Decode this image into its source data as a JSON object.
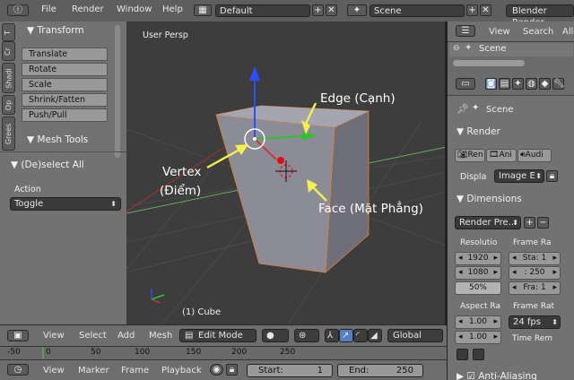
{
  "top_menu": {
    "file": "File",
    "render": "Render",
    "window": "Window",
    "help": "Help",
    "screen_layout": "Default",
    "scene": "Scene",
    "engine": "Blender Render"
  },
  "toolshelf": {
    "tabs": [
      "T",
      "Cr",
      "Shadi",
      "Op",
      "Grees"
    ],
    "transform_header": "Transform",
    "transform_buttons": [
      "Translate",
      "Rotate",
      "Scale",
      "Shrink/Fatten",
      "Push/Pull"
    ],
    "mesh_tools_header": "Mesh Tools",
    "deselect_header": "(De)select All",
    "action_label": "Action",
    "action_value": "Toggle"
  },
  "viewport": {
    "view_label": "User Persp",
    "object_label": "(1) Cube",
    "annotations": {
      "edge": "Edge (Cạnh)",
      "vertex_line1": "Vertex",
      "vertex_line2": "(Điểm)",
      "face": "Face (Mặt Phẳng)"
    }
  },
  "viewport_header": {
    "view": "View",
    "select": "Select",
    "add": "Add",
    "mesh": "Mesh",
    "mode": "Edit Mode",
    "orientation": "Global"
  },
  "outliner": {
    "view": "View",
    "search": "Search",
    "all": "All",
    "scene": "Scene"
  },
  "properties": {
    "scene_crumb": "Scene",
    "render_header": "Render",
    "render_buttons": [
      "Ren",
      "Ani",
      "Audi"
    ],
    "display_label": "Displa",
    "display_value": "Image E",
    "dimensions_header": "Dimensions",
    "render_preset": "Render Pre...",
    "resolution_label": "Resolutio",
    "res_x": "1920",
    "res_y": "1080",
    "res_pct": "50%",
    "frame_range_label": "Frame Ra",
    "frame_start": "Sta: 1",
    "frame_end": ": 250",
    "frame_step": "Fra: 1",
    "aspect_label": "Aspect Ra",
    "aspect_x": "1.00",
    "aspect_y": "1.00",
    "frame_rate_label": "Frame Rat",
    "fps": "24 fps",
    "time_remap_label": "Time Rem",
    "anti_aliasing": "Anti-Aliasing"
  },
  "timeline": {
    "ticks": [
      "-50",
      "0",
      "50",
      "100",
      "150",
      "200",
      "250"
    ],
    "view": "View",
    "marker": "Marker",
    "frame": "Frame",
    "playback": "Playback",
    "start_label": "Start:",
    "start_value": "1",
    "end_label": "End:",
    "end_value": "250"
  },
  "colors": {
    "x_axis": "#c83a3a",
    "y_axis": "#2ec22e",
    "z_axis": "#2a4dff",
    "annot_arrow": "#f5f04a"
  }
}
